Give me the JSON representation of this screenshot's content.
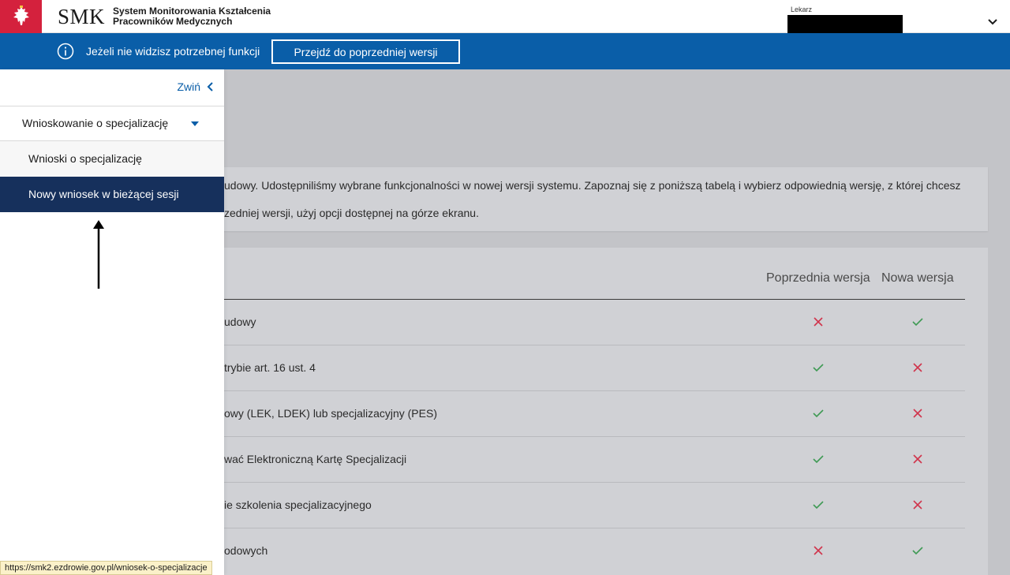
{
  "header": {
    "brand_mark": "SMK",
    "brand_line1": "System Monitorowania Kształcenia",
    "brand_line2": "Pracowników Medycznych",
    "role_label": "Lekarz",
    "emblem_icon": "eagle-emblem-icon",
    "emblem_color": "#d4213d"
  },
  "infobar": {
    "text": "Jeżeli nie widzisz potrzebnej funkcji",
    "button_label": "Przejdź do poprzedniej wersji",
    "background": "#0a5ea8"
  },
  "sidebar": {
    "collapse_label": "Zwiń",
    "group_label": "Wnioskowanie o specjalizację",
    "items": [
      {
        "label": "Wnioski o specjalizację",
        "active": false
      },
      {
        "label": "Nowy wniosek w bieżącej sesji",
        "active": true
      }
    ],
    "active_color": "#16305c"
  },
  "main": {
    "info_line1": "udowy. Udostępniliśmy wybrane funkcjonalności w nowej wersji systemu. Zapoznaj się z poniższą tabelą i wybierz odpowiednią wersję, z której chcesz",
    "info_line2": "zedniej wersji, użyj opcji dostępnej na górze ekranu.",
    "table": {
      "col_prev": "Poprzednia wersja",
      "col_new": "Nowa wersja",
      "rows": [
        {
          "label": "udowy",
          "prev": "cross",
          "new": "check"
        },
        {
          "label": "trybie art. 16 ust. 4",
          "prev": "check",
          "new": "cross"
        },
        {
          "label": "owy (LEK, LDEK) lub specjalizacyjny (PES)",
          "prev": "check",
          "new": "cross"
        },
        {
          "label": "wać Elektroniczną Kartę Specjalizacji",
          "prev": "check",
          "new": "cross"
        },
        {
          "label": "ie szkolenia specjalizacyjnego",
          "prev": "check",
          "new": "cross"
        },
        {
          "label": "odowych",
          "prev": "cross",
          "new": "check"
        }
      ],
      "check_color": "#3f9a54",
      "cross_color": "#d0344c"
    }
  },
  "status_url": "https://smk2.ezdrowie.gov.pl/wniosek-o-specjalizacje"
}
